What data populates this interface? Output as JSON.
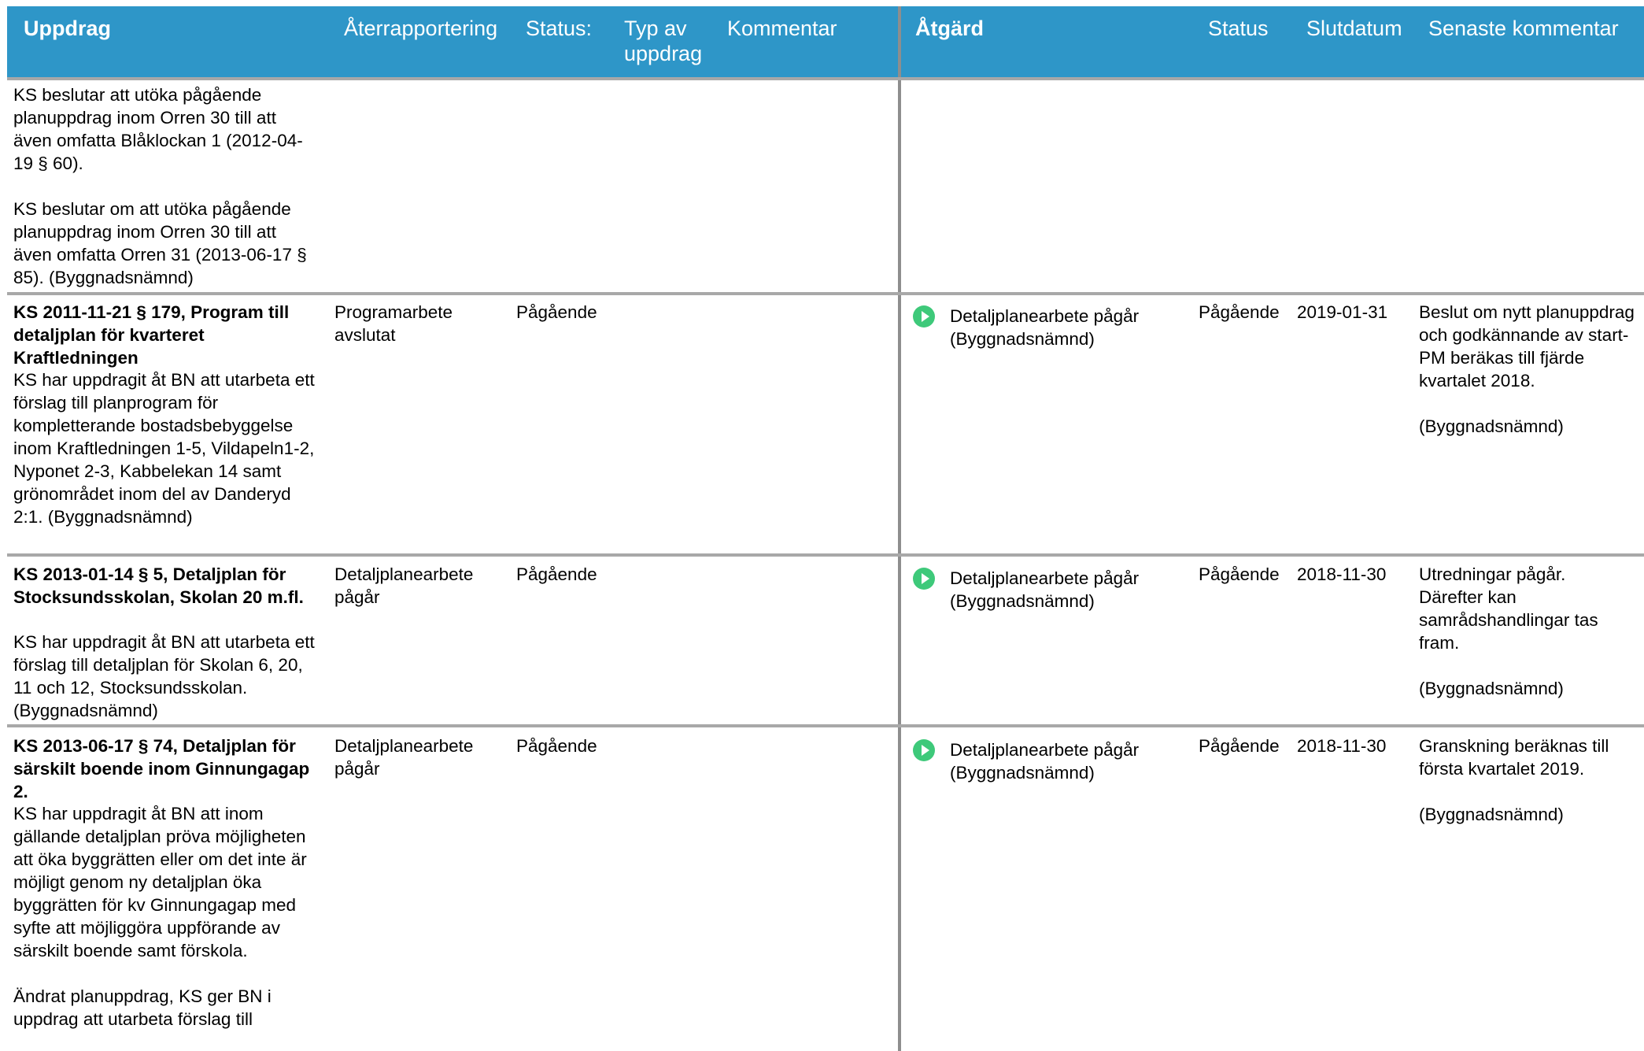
{
  "header": {
    "uppdrag": "Uppdrag",
    "aterrapportering": "Återrapportering",
    "status": "Status:",
    "typ": "Typ av uppdrag",
    "kommentar": "Kommentar",
    "atgard": "Åtgärd",
    "atgard_status": "Status",
    "slutdatum": "Slutdatum",
    "senaste": "Senaste kommentar"
  },
  "rows": [
    {
      "title": "",
      "desc": "KS beslutar att utöka pågående planuppdrag inom Orren 30 till att även omfatta Blåklockan 1 (2012-04-19 § 60).\n\nKS beslutar om att utöka pågående planuppdrag inom Orren 30 till att även omfatta Orren 31 (2013-06-17 § 85). (Byggnadsnämnd)",
      "aterrapportering": "",
      "status": "",
      "typ": "",
      "kommentar": "",
      "atgard": "",
      "atgard_status": "",
      "slutdatum": "",
      "senaste": ""
    },
    {
      "title": "KS 2011-11-21 § 179, Program till detaljplan för kvarteret Kraftledningen",
      "desc": "KS har uppdragit åt BN att utarbeta ett förslag till planprogram för kompletterande bostadsbebyggelse inom Kraftledningen 1-5, Vildapeln1-2, Nyponet 2-3, Kabbelekan 14 samt grönområdet inom del av Danderyd 2:1. (Byggnadsnämnd)",
      "aterrapportering": "Programarbete avslutat",
      "status": "Pågående",
      "typ": "",
      "kommentar": "",
      "atgard": "Detaljplanearbete pågår (Byggnadsnämnd)",
      "atgard_status": "Pågående",
      "slutdatum": "2019-01-31",
      "senaste": "Beslut om nytt planuppdrag och godkännande av start-PM beräkas till fjärde kvartalet 2018.\n\n(Byggnadsnämnd)"
    },
    {
      "title": "KS 2013-01-14 § 5, Detaljplan för Stocksundsskolan, Skolan 20 m.fl.",
      "desc": "KS har uppdragit åt BN att utarbeta ett förslag till detaljplan för Skolan 6, 20, 11 och 12, Stocksundsskolan. (Byggnadsnämnd)",
      "aterrapportering": "Detaljplanearbete pågår",
      "status": "Pågående",
      "typ": "",
      "kommentar": "",
      "atgard": "Detaljplanearbete pågår (Byggnadsnämnd)",
      "atgard_status": "Pågående",
      "slutdatum": "2018-11-30",
      "senaste": "Utredningar pågår. Därefter kan samrådshandlingar tas fram.\n\n(Byggnadsnämnd)"
    },
    {
      "title": "KS 2013-06-17 § 74, Detaljplan för särskilt boende inom Ginnungagap 2.",
      "desc": "KS har uppdragit åt BN att inom gällande detaljplan pröva möjligheten att öka byggrätten eller om det inte är möjligt genom ny detaljplan öka byggrätten för kv Ginnungagap med syfte att möjliggöra uppförande av särskilt boende samt förskola.\n\nÄndrat planuppdrag, KS ger BN i uppdrag att utarbeta förslag till",
      "aterrapportering": "Detaljplanearbete pågår",
      "status": "Pågående",
      "typ": "",
      "kommentar": "",
      "atgard": "Detaljplanearbete pågår (Byggnadsnämnd)",
      "atgard_status": "Pågående",
      "slutdatum": "2018-11-30",
      "senaste": "Granskning beräknas till första kvartalet 2019.\n\n(Byggnadsnämnd)"
    }
  ],
  "icons": {
    "status": "play-circle-icon",
    "color": "#3ec97a"
  },
  "colors": {
    "header": "#2e96c8"
  }
}
